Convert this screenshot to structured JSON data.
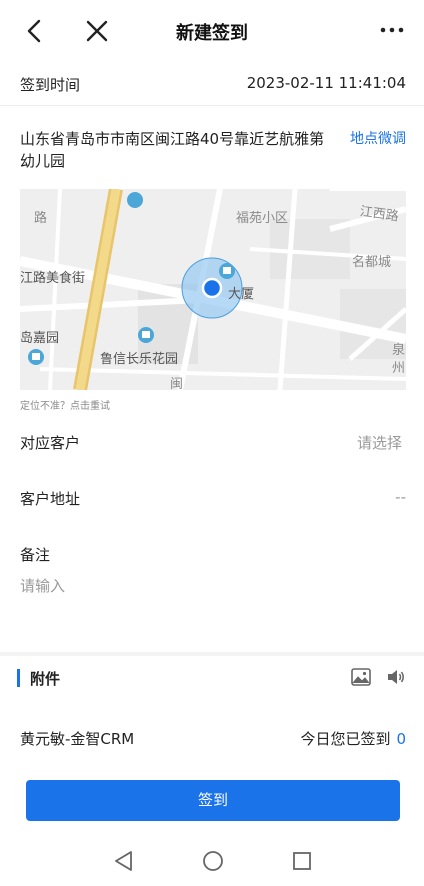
{
  "header": {
    "title": "新建签到",
    "icons": {
      "back": "back-arrow-icon",
      "close": "close-icon",
      "more": "more-dots-icon"
    }
  },
  "checkin_time": {
    "label": "签到时间",
    "value": "2023-02-11 11:41:04"
  },
  "location": {
    "address": "山东省青岛市市南区闽江路40号靠近艺航雅第幼儿园",
    "adjust_link": "地点微调"
  },
  "map": {
    "pois": [
      "江西路",
      "福苑小区",
      "名都城",
      "江路美食街",
      "岛嘉园",
      "鲁信长乐花园",
      "大厦",
      "泉",
      "州",
      "路",
      "闽"
    ]
  },
  "retry_hint": "定位不准？点击重试",
  "customer": {
    "label": "对应客户",
    "placeholder": "请选择"
  },
  "customer_address": {
    "label": "客户地址",
    "value": "--"
  },
  "remark": {
    "label": "备注",
    "placeholder": "请输入"
  },
  "attachments": {
    "label": "附件",
    "icons": [
      "image-icon",
      "voice-icon"
    ]
  },
  "footer_info": {
    "user": "黄元敏-金智CRM",
    "today_label": "今日您已签到",
    "today_count": "0"
  },
  "submit_label": "签到",
  "colors": {
    "accent": "#1a73e8",
    "map_bg": "#efefef"
  }
}
